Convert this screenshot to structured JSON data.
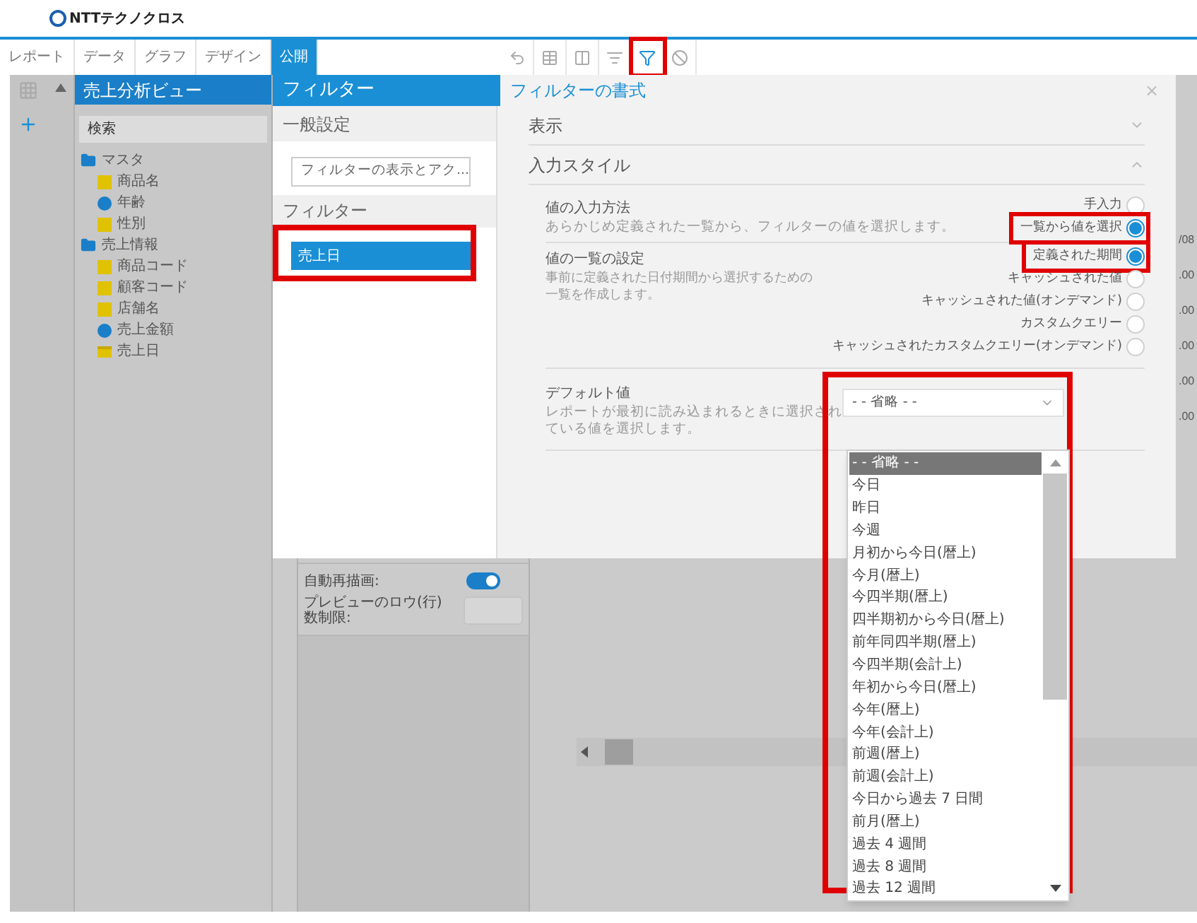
{
  "logo": {
    "text": "NTTテクノクロス"
  },
  "tabs": [
    {
      "label": "レポート",
      "selected": false
    },
    {
      "label": "データ",
      "selected": false
    },
    {
      "label": "グラフ",
      "selected": false
    },
    {
      "label": "デザイン",
      "selected": false
    },
    {
      "label": "公開",
      "selected": true
    }
  ],
  "toolbar": [
    {
      "kind": "undo",
      "highlighted": false
    },
    {
      "kind": "table",
      "highlighted": false
    },
    {
      "kind": "columns",
      "highlighted": false
    },
    {
      "kind": "list",
      "highlighted": false
    },
    {
      "kind": "filter",
      "highlighted": true
    },
    {
      "kind": "block",
      "highlighted": false
    }
  ],
  "data_tree": {
    "title": "売上分析ビュー",
    "search_placeholder": "検索",
    "folders": [
      {
        "label": "マスタ",
        "children": [
          {
            "label": "商品名",
            "kind": "dimension"
          },
          {
            "label": "年齢",
            "kind": "measure"
          },
          {
            "label": "性別",
            "kind": "dimension"
          }
        ]
      },
      {
        "label": "売上情報",
        "children": [
          {
            "label": "商品コード",
            "kind": "dimension"
          },
          {
            "label": "顧客コード",
            "kind": "dimension"
          },
          {
            "label": "店舗名",
            "kind": "dimension"
          },
          {
            "label": "売上金額",
            "kind": "measure"
          },
          {
            "label": "売上日",
            "kind": "date"
          }
        ]
      }
    ]
  },
  "preview_settings": [
    {
      "label": "自動再描画:",
      "kind": "toggle",
      "on": true
    },
    {
      "label": "プレビューのロウ(行)数制限:",
      "kind": "field"
    }
  ],
  "background_values": [
    "/08",
    ".00",
    ".00",
    ".00",
    ".00",
    ".00"
  ],
  "filter_panel": {
    "title": "フィルター",
    "general_heading": "一般設定",
    "general_button": "フィルターの表示とアク...",
    "filters_heading": "フィルター",
    "filters": [
      {
        "label": "売上日",
        "selected": true,
        "highlighted": true
      }
    ]
  },
  "format_panel": {
    "title": "フィルターの書式",
    "close": "×",
    "sections": [
      {
        "label": "表示",
        "expanded": false
      },
      {
        "label": "入力スタイル",
        "expanded": true
      }
    ],
    "input_method": {
      "label": "値の入力方法",
      "description": "あらかじめ定義された一覧から、フィルターの値を選択します。",
      "options": [
        {
          "label": "手入力",
          "selected": false,
          "highlighted": false
        },
        {
          "label": "一覧から値を選択",
          "selected": true,
          "highlighted": true
        }
      ]
    },
    "value_list": {
      "label": "値の一覧の設定",
      "description": "事前に定義された日付期間から選択するための一覧を作成します。",
      "options": [
        {
          "label": "定義された期間",
          "selected": true,
          "highlighted": true
        },
        {
          "label": "キャッシュされた値",
          "selected": false,
          "highlighted": false
        },
        {
          "label": "キャッシュされた値(オンデマンド)",
          "selected": false,
          "highlighted": false
        },
        {
          "label": "カスタムクエリー",
          "selected": false,
          "highlighted": false
        },
        {
          "label": "キャッシュされたカスタムクエリー(オンデマンド)",
          "selected": false,
          "highlighted": false
        }
      ]
    },
    "default_value": {
      "label": "デフォルト値",
      "description_lines": [
        "レポートが最初に読み込まれるときに選択され",
        "ている値を選択します。"
      ],
      "value": "- - 省略 - -",
      "highlighted": true,
      "expanded": true,
      "options": [
        {
          "label": "- - 省略 - -",
          "selected": true
        },
        {
          "label": "今日",
          "selected": false
        },
        {
          "label": "昨日",
          "selected": false
        },
        {
          "label": "今週",
          "selected": false
        },
        {
          "label": "月初から今日(暦上)",
          "selected": false
        },
        {
          "label": "今月(暦上)",
          "selected": false
        },
        {
          "label": "今四半期(暦上)",
          "selected": false
        },
        {
          "label": "四半期初から今日(暦上)",
          "selected": false
        },
        {
          "label": "前年同四半期(暦上)",
          "selected": false
        },
        {
          "label": "今四半期(会計上)",
          "selected": false
        },
        {
          "label": "年初から今日(暦上)",
          "selected": false
        },
        {
          "label": "今年(暦上)",
          "selected": false
        },
        {
          "label": "今年(会計上)",
          "selected": false
        },
        {
          "label": "前週(暦上)",
          "selected": false
        },
        {
          "label": "前週(会計上)",
          "selected": false
        },
        {
          "label": "今日から過去 7 日間",
          "selected": false
        },
        {
          "label": "前月(暦上)",
          "selected": false
        },
        {
          "label": "過去 4 週間",
          "selected": false
        },
        {
          "label": "過去 8 週間",
          "selected": false
        },
        {
          "label": "過去 12 週間",
          "selected": false
        }
      ]
    }
  }
}
